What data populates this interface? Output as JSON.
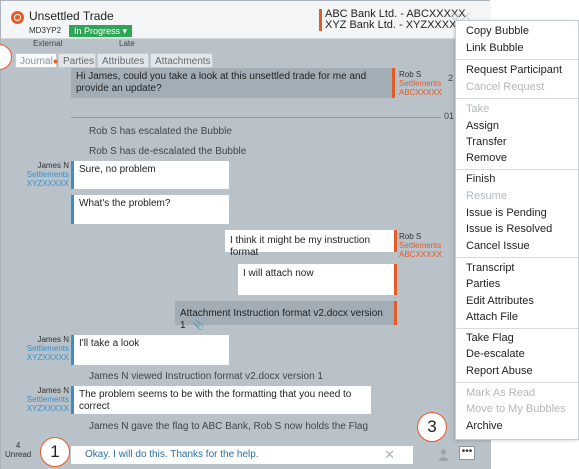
{
  "header": {
    "title": "Unsettled Trade",
    "ref": "MD3YP2",
    "status": "In Progress",
    "status_color": "#2fa558",
    "external": "External",
    "late": "Late",
    "party_a": "ABC Bank Ltd. - ABCXXXXX",
    "party_b": "XYZ Bank Ltd. - XYZXXXXX"
  },
  "tabs": [
    "Journal",
    "Parties",
    "Attributes",
    "Attachments"
  ],
  "messages": {
    "m1": {
      "text": "Hi James, could you take a look at this unsettled trade for me and provide an update?",
      "name": "Rob S",
      "role": "Settlements",
      "org": "ABCXXXXX",
      "count": "2"
    },
    "date_tick": "01",
    "sys1": "Rob S has escalated the Bubble",
    "sys2": "Rob S has de-escalated the Bubble",
    "m2": {
      "text": "Sure, no problem",
      "name": "James N",
      "role": "Settlements",
      "org": "XYZXXXXX"
    },
    "m3": {
      "text": "What's the problem?"
    },
    "m4": {
      "text": "I think it might be my instruction format",
      "name": "Rob S",
      "role": "Settlements",
      "org": "ABCXXXXX"
    },
    "m5": {
      "text": "I will attach now"
    },
    "m6": {
      "text": "Attachment Instruction format v2.docx version 1"
    },
    "m7": {
      "text": "I'll take a look",
      "name": "James N",
      "role": "Settlements",
      "org": "XYZXXXXX"
    },
    "sys3": "James N viewed Instruction format v2.docx version 1",
    "m8": {
      "text": "The problem seems to be with the formatting that you need to correct",
      "name": "James N",
      "role": "Settlements",
      "org": "XYZXXXXX"
    },
    "sys4": "James N gave the flag to ABC Bank, Rob S now holds the Flag"
  },
  "composer": {
    "value": "Okay. I will do this. Thanks for the help.",
    "unread_count": "4",
    "unread_label": "Unread",
    "more_label": "•••"
  },
  "callouts": {
    "c1": "1",
    "c3": "3"
  },
  "menu": {
    "copy_bubble": "Copy Bubble",
    "link_bubble": "Link Bubble",
    "request_participant": "Request Participant",
    "cancel_request": "Cancel Request",
    "take": "Take",
    "assign": "Assign",
    "transfer": "Transfer",
    "remove": "Remove",
    "finish": "Finish",
    "resume": "Resume",
    "issue_pending": "Issue is Pending",
    "issue_resolved": "Issue is Resolved",
    "cancel_issue": "Cancel Issue",
    "transcript": "Transcript",
    "parties": "Parties",
    "edit_attributes": "Edit Attributes",
    "attach_file": "Attach File",
    "take_flag": "Take Flag",
    "de_escalate": "De-escalate",
    "report_abuse": "Report Abuse",
    "mark_as_read": "Mark As Read",
    "move_to_my_bubbles": "Move to My Bubbles",
    "archive": "Archive"
  },
  "colors": {
    "accent": "#e65a25",
    "in_bar": "#3a8fc9",
    "chat_bg": "#b9c2c8"
  }
}
